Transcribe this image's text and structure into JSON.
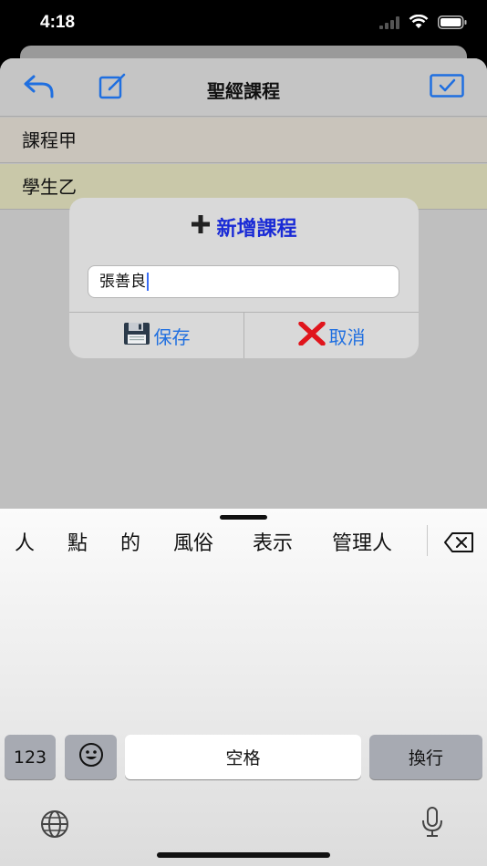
{
  "status_bar": {
    "time": "4:18"
  },
  "nav": {
    "title": "聖經課程"
  },
  "rows": [
    {
      "label": "課程甲"
    },
    {
      "label": "學生乙"
    }
  ],
  "dialog": {
    "title": "新增課程",
    "input_value": "張善良",
    "save_label": "保存",
    "cancel_label": "取消"
  },
  "keyboard": {
    "candidates": [
      "人",
      "點",
      "的",
      "風俗",
      "表示",
      "管理人"
    ],
    "numbers_key": "123",
    "space_key": "空格",
    "return_key": "換行"
  },
  "colors": {
    "accent_blue": "#1f6fe0",
    "dialog_title": "#1a2bd6",
    "cancel_red": "#e0151c"
  }
}
